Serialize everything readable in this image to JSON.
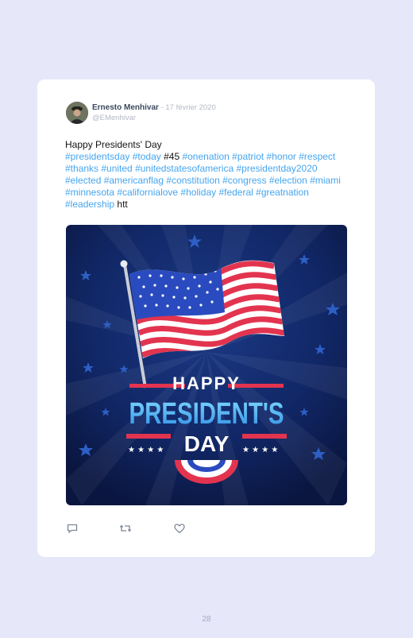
{
  "tweet": {
    "author_name": "Ernesto Menhivar",
    "date": " - 17 février 2020",
    "handle": "@EMenhivar",
    "line1": "Happy Presidents' Day",
    "segments": [
      {
        "text": "#presidentsday #today ",
        "tag": true
      },
      {
        "text": "#45 ",
        "tag": false
      },
      {
        "text": "#onenation #patriot #honor #respect #thanks #united #unitedstatesofamerica #presidentday2020 #elected #americanflag #constitution #congress #election #miami #minnesota #californialove #holiday #federal #greatnation #leadership ",
        "tag": true
      },
      {
        "text": "htt",
        "tag": false
      }
    ]
  },
  "image": {
    "line1": "HAPPY",
    "line2": "PRESIDENT'S",
    "line3": "DAY"
  },
  "actions": {
    "reply_icon": "reply-icon",
    "retweet_icon": "retweet-icon",
    "like_icon": "like-icon"
  },
  "page_number": "28",
  "colors": {
    "background": "#e6e7f8",
    "card": "#ffffff",
    "hashtag": "#46a5ef",
    "image_bg": "#0f2150",
    "banner_red": "#e3344f"
  }
}
